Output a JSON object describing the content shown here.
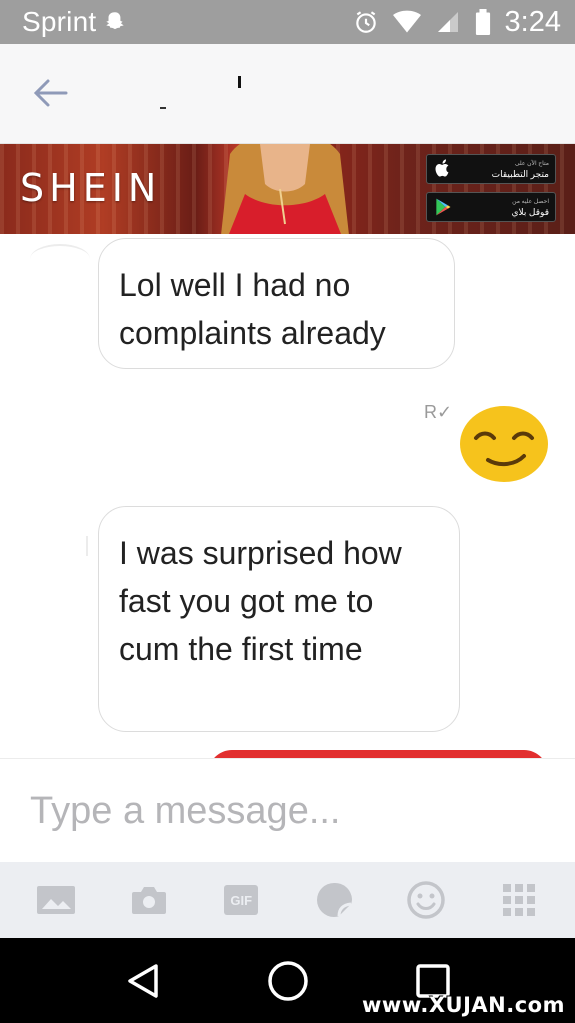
{
  "status_bar": {
    "carrier": "Sprint",
    "time": "3:24",
    "icons": [
      "snapchat-icon",
      "alarm-icon",
      "wifi-icon",
      "signal-icon",
      "battery-icon"
    ]
  },
  "header": {
    "back_icon": "arrow-left-icon"
  },
  "ad": {
    "brand": "SHEIN",
    "app_store_label": "متجر التطبيقات",
    "app_store_sub": "متاح الآن على",
    "google_play_label": "قوقل بلاي",
    "google_play_sub": "احصل عليه من"
  },
  "messages": [
    {
      "direction": "incoming",
      "text": "Lol well I had no complaints already"
    },
    {
      "direction": "outgoing",
      "emoji": "smirking-face",
      "receipt": "R✓"
    },
    {
      "direction": "incoming",
      "text": "I was surprised how fast you got me to cum the first time"
    }
  ],
  "composer": {
    "placeholder": "Type a message..."
  },
  "toolbar": {
    "gif_label": "GIF",
    "items": [
      "gallery-icon",
      "camera-icon",
      "gif-icon",
      "sticker-icon",
      "emoji-icon",
      "apps-grid-icon"
    ]
  },
  "nav_bar": {
    "items": [
      "back-triangle-icon",
      "home-circle-icon",
      "recents-square-icon"
    ]
  },
  "watermark": "www.XUJAN.com",
  "colors": {
    "status_bar": "#9e9e9e",
    "header_bg": "#f7f7f8",
    "toolbar_bg": "#eceef2",
    "accent_red": "#e22f2f",
    "emoji_yellow": "#f6c31c"
  }
}
